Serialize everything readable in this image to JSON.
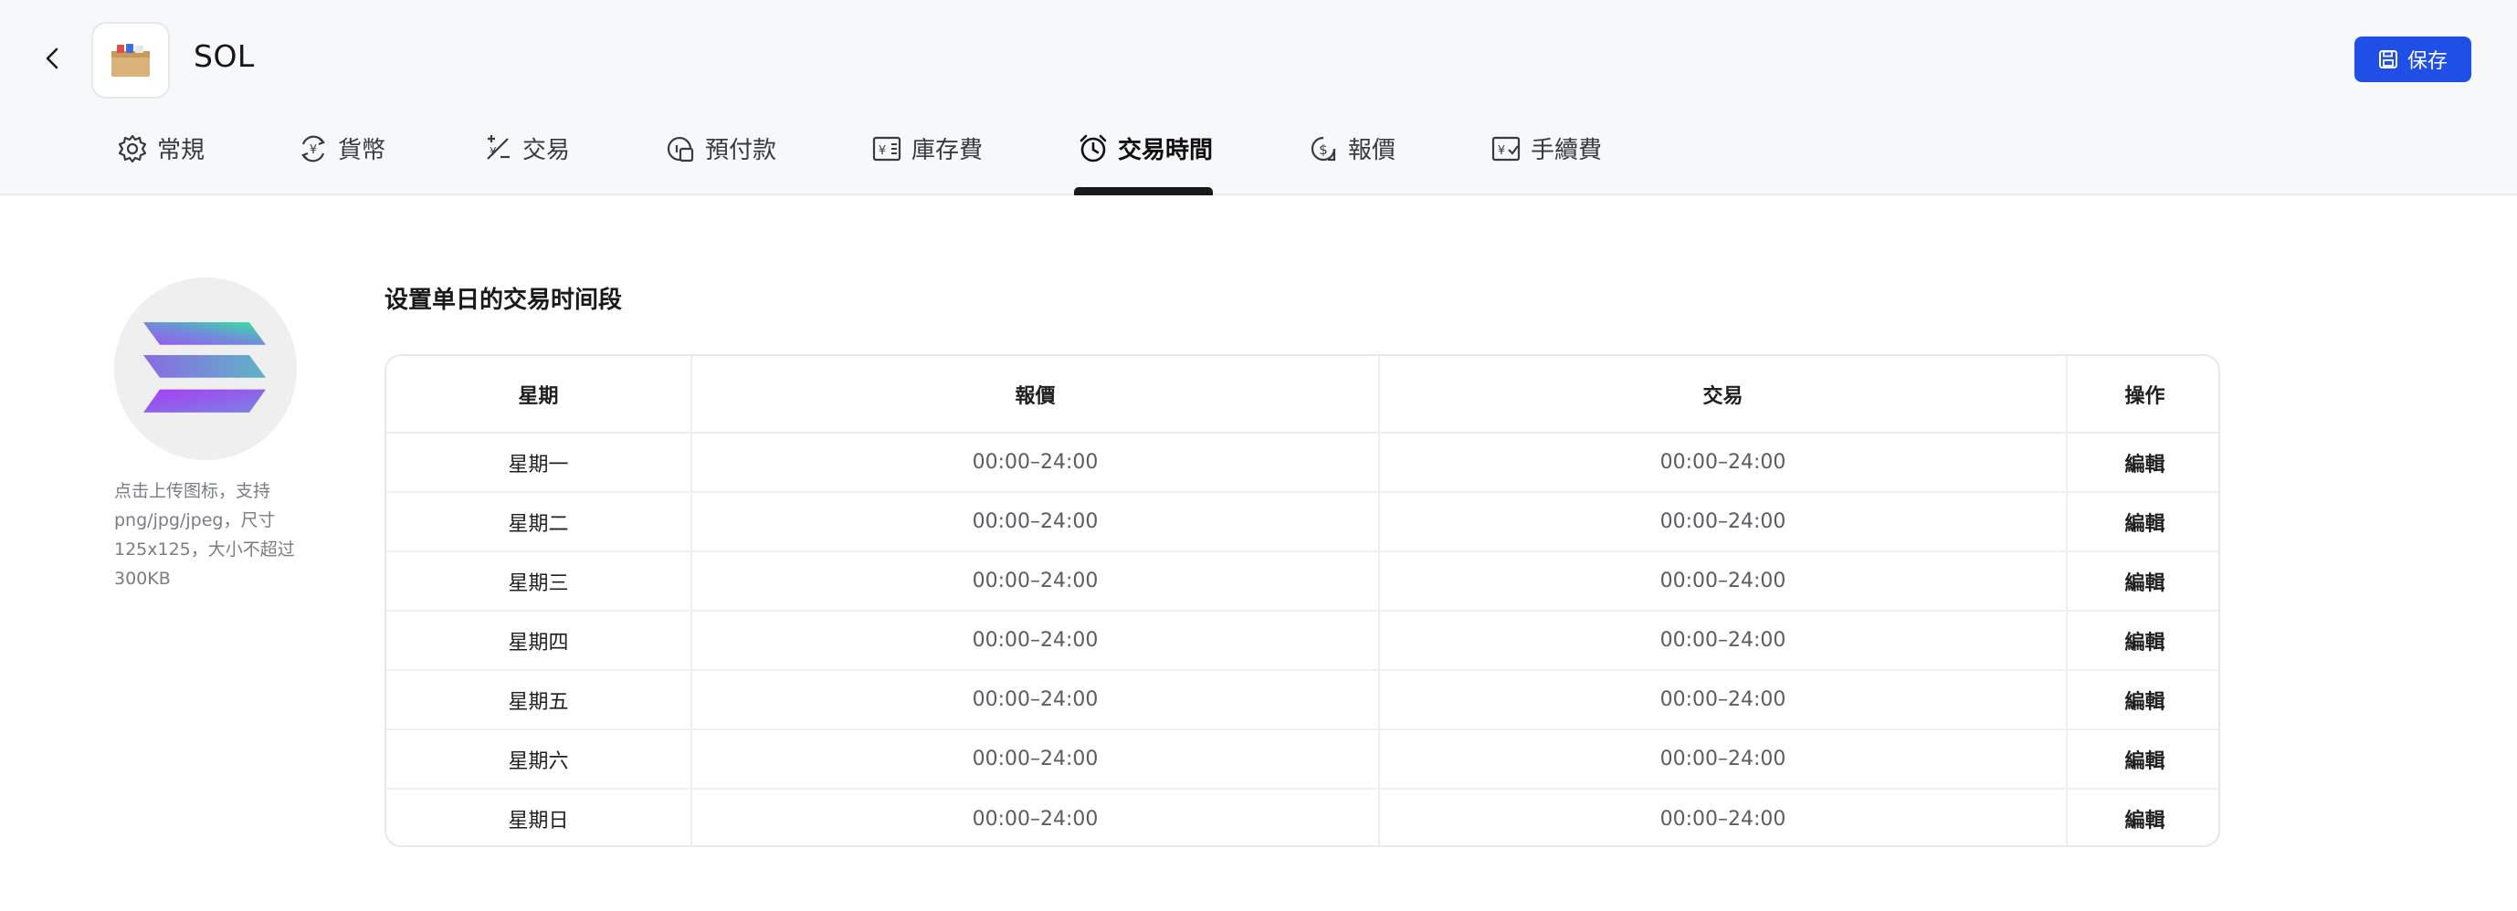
{
  "header": {
    "title": "SOL",
    "save_label": "保存"
  },
  "tabs": [
    {
      "label": "常規",
      "icon": "gear-icon"
    },
    {
      "label": "貨幣",
      "icon": "currency-exchange-icon"
    },
    {
      "label": "交易",
      "icon": "trade-icon"
    },
    {
      "label": "預付款",
      "icon": "prepayment-icon"
    },
    {
      "label": "庫存費",
      "icon": "storage-fee-icon"
    },
    {
      "label": "交易時間",
      "icon": "clock-icon",
      "active": true
    },
    {
      "label": "報價",
      "icon": "quote-icon"
    },
    {
      "label": "手續費",
      "icon": "fee-icon"
    }
  ],
  "upload": {
    "hint": "点击上传图标，支持png/jpg/jpeg，尺寸125x125，大小不超过300KB"
  },
  "section": {
    "title": "设置单日的交易时间段"
  },
  "table": {
    "headers": [
      "星期",
      "報價",
      "交易",
      "操作"
    ],
    "rows": [
      {
        "day": "星期一",
        "quote": "00:00–24:00",
        "trade": "00:00–24:00",
        "action": "編輯"
      },
      {
        "day": "星期二",
        "quote": "00:00–24:00",
        "trade": "00:00–24:00",
        "action": "編輯"
      },
      {
        "day": "星期三",
        "quote": "00:00–24:00",
        "trade": "00:00–24:00",
        "action": "編輯"
      },
      {
        "day": "星期四",
        "quote": "00:00–24:00",
        "trade": "00:00–24:00",
        "action": "編輯"
      },
      {
        "day": "星期五",
        "quote": "00:00–24:00",
        "trade": "00:00–24:00",
        "action": "編輯"
      },
      {
        "day": "星期六",
        "quote": "00:00–24:00",
        "trade": "00:00–24:00",
        "action": "編輯"
      },
      {
        "day": "星期日",
        "quote": "00:00–24:00",
        "trade": "00:00–24:00",
        "action": "編輯"
      }
    ]
  },
  "colors": {
    "primary": "#1f4fe6",
    "header_bg": "#f7f8fa",
    "active_tab": "#1a1a1a"
  }
}
